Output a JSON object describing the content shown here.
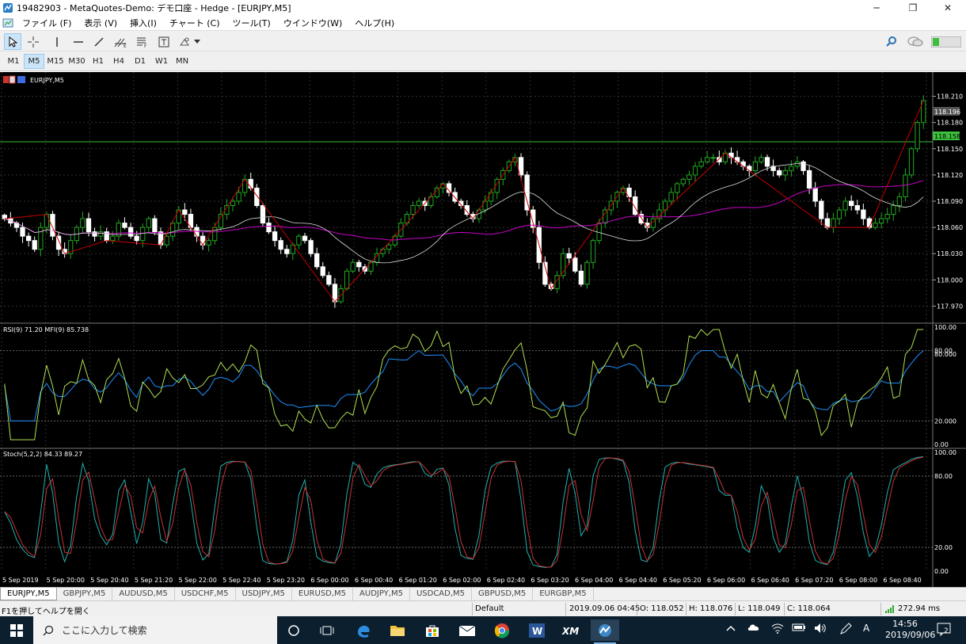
{
  "window": {
    "title": "19482903 - MetaQuotes-Demo: デモ口座 - Hedge - [EURJPY,M5]",
    "minimize": "─",
    "maximize": "❐",
    "close": "✕"
  },
  "menu": [
    "ファイル (F)",
    "表示 (V)",
    "挿入(I)",
    "チャート (C)",
    "ツール(T)",
    "ウインドウ(W)",
    "ヘルプ(H)"
  ],
  "mdi": {
    "min": "-",
    "restore": "#",
    "close": "x"
  },
  "timeframes": [
    "M1",
    "M5",
    "M15",
    "M30",
    "H1",
    "H4",
    "D1",
    "W1",
    "MN"
  ],
  "active_timeframe": "M5",
  "chart": {
    "symbol_label": "EURJPY,M5",
    "price_labels": [
      "118.210",
      "118.180",
      "118.150",
      "118.120",
      "118.090",
      "118.060",
      "118.030",
      "118.000",
      "117.970"
    ],
    "current_price_tag": "118.196",
    "bid_line_tag": "118.158",
    "rsi_label": "RSI(9) 71.20 MFI(9) 85.738",
    "rsi_levels": [
      "100.00",
      "80.00",
      "80.000",
      "20.000",
      "0.00"
    ],
    "stoch_label": "Stoch(5,2,2) 84.33 89.27",
    "stoch_levels": [
      "100.00",
      "80.00",
      "20.00",
      "0.00"
    ],
    "time_labels": [
      "5 Sep 2019",
      "5 Sep 20:00",
      "5 Sep 20:40",
      "5 Sep 21:20",
      "5 Sep 22:00",
      "5 Sep 22:40",
      "5 Sep 23:20",
      "6 Sep 00:00",
      "6 Sep 00:40",
      "6 Sep 01:20",
      "6 Sep 02:00",
      "6 Sep 02:40",
      "6 Sep 03:20",
      "6 Sep 04:00",
      "6 Sep 04:40",
      "6 Sep 05:20",
      "6 Sep 06:00",
      "6 Sep 06:40",
      "6 Sep 07:20",
      "6 Sep 08:00",
      "6 Sep 08:40"
    ]
  },
  "chart_data": {
    "type": "candlestick",
    "symbol": "EURJPY",
    "timeframe": "M5",
    "ylim": [
      117.955,
      118.225
    ],
    "close": [
      118.07,
      118.065,
      118.06,
      118.05,
      118.045,
      118.035,
      118.06,
      118.075,
      118.05,
      118.035,
      118.03,
      118.045,
      118.06,
      118.07,
      118.055,
      118.05,
      118.055,
      118.045,
      118.05,
      118.065,
      118.06,
      118.05,
      118.045,
      118.06,
      118.07,
      118.055,
      118.04,
      118.05,
      118.065,
      118.08,
      118.075,
      118.06,
      118.05,
      118.04,
      118.045,
      118.06,
      118.075,
      118.085,
      118.09,
      118.1,
      118.115,
      118.105,
      118.085,
      118.065,
      118.055,
      118.045,
      118.035,
      118.03,
      118.04,
      118.05,
      118.045,
      118.03,
      118.015,
      118.005,
      117.995,
      117.975,
      117.99,
      118.01,
      118.02,
      118.015,
      118.01,
      118.02,
      118.03,
      118.035,
      118.04,
      118.05,
      118.065,
      118.075,
      118.085,
      118.09,
      118.085,
      118.095,
      118.105,
      118.11,
      118.1,
      118.09,
      118.085,
      118.075,
      118.07,
      118.08,
      118.09,
      118.1,
      118.115,
      118.125,
      118.135,
      118.14,
      118.12,
      118.08,
      118.06,
      118.02,
      117.995,
      117.99,
      118.005,
      118.03,
      118.025,
      118.01,
      117.995,
      118.02,
      118.045,
      118.065,
      118.08,
      118.09,
      118.1,
      118.105,
      118.095,
      118.075,
      118.065,
      118.06,
      118.07,
      118.08,
      118.09,
      118.1,
      118.11,
      118.115,
      118.12,
      118.13,
      118.135,
      118.14,
      118.14,
      118.135,
      118.145,
      118.14,
      118.135,
      118.13,
      118.125,
      118.135,
      118.14,
      118.13,
      118.125,
      118.12,
      118.125,
      118.13,
      118.135,
      118.125,
      118.105,
      118.09,
      118.07,
      118.06,
      118.07,
      118.08,
      118.09,
      118.085,
      118.08,
      118.07,
      118.06,
      118.065,
      118.07,
      118.075,
      118.085,
      118.095,
      118.12,
      118.15,
      118.18,
      118.205
    ],
    "ma_pink": "slow moving average",
    "ma_white": "fast moving average",
    "rsi": {
      "levels": [
        20,
        80
      ],
      "ylim": [
        0,
        100
      ]
    },
    "stoch": {
      "levels": [
        20,
        80
      ],
      "ylim": [
        0,
        100
      ]
    }
  },
  "symbol_tabs": [
    "EURJPY,M5",
    "GBPJPY,M5",
    "AUDUSD,M5",
    "USDCHF,M5",
    "USDJPY,M5",
    "EURUSD,M5",
    "AUDJPY,M5",
    "USDCAD,M5",
    "GBPUSD,M5",
    "EURGBP,M5"
  ],
  "status": {
    "help": "F1を押してヘルプを開く",
    "profile": "Default",
    "datetime": "2019.09.06 04:45",
    "open": "O: 118.052",
    "high": "H: 118.076",
    "low": "L: 118.049",
    "close": "C: 118.064",
    "ping": "272.94 ms"
  },
  "taskbar": {
    "search_placeholder": "ここに入力して検索",
    "time": "14:56",
    "date": "2019/09/06",
    "ime": "A",
    "notif_count": "2"
  },
  "colors": {
    "chart_bg": "#000000",
    "grid": "#2f2f2f",
    "bull": "#22aa22",
    "bear": "#ffffff",
    "zigzag": "#c80000",
    "ma_pink": "#c800c8",
    "ma_white": "#dcdcdc",
    "rsi": "#1e90ff",
    "mfi": "#b0e050",
    "stoch_main": "#20b0b0",
    "stoch_signal": "#c83232"
  }
}
